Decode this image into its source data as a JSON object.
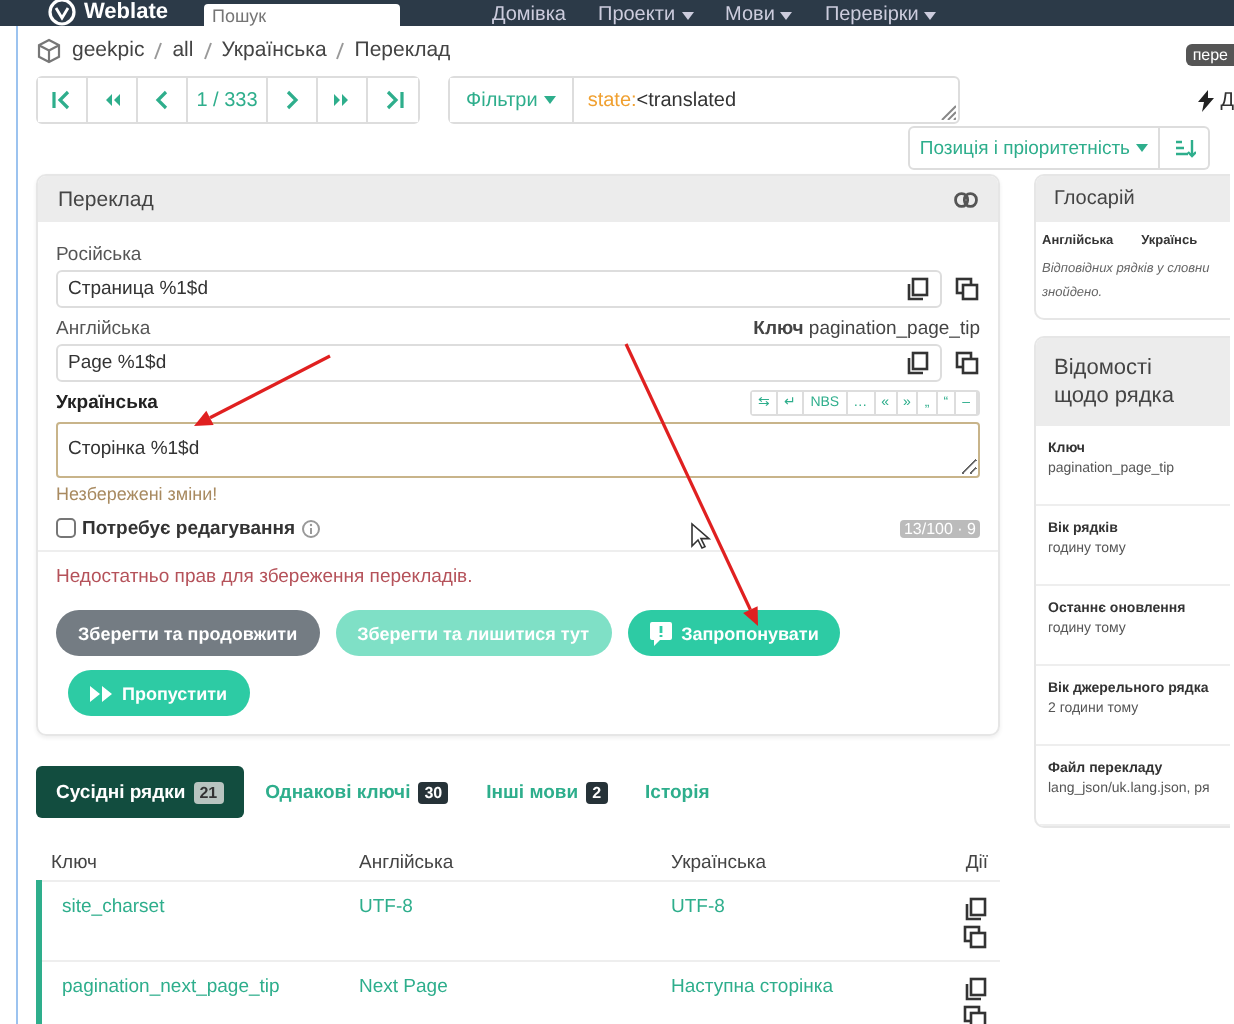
{
  "topbar": {
    "brand": "Weblate",
    "search": {
      "placeholder": "Пошук"
    },
    "menu": [
      {
        "label": "Домівка",
        "dropdown": false
      },
      {
        "label": "Проекти",
        "dropdown": true
      },
      {
        "label": "Мови",
        "dropdown": true
      },
      {
        "label": "Перевірки",
        "dropdown": true
      }
    ]
  },
  "breadcrumb": [
    "geekpic",
    "all",
    "Українська",
    "Переклад"
  ],
  "tooltip": "пере",
  "pager": {
    "position": "1 / 333"
  },
  "filter": {
    "label": "Фільтри",
    "query_key": "state:",
    "query_value": "<translated"
  },
  "zen_label": "Д",
  "sort": {
    "label": "Позиція і пріоритетність"
  },
  "translation": {
    "title": "Переклад",
    "sources": [
      {
        "language": "Російська",
        "text": "Страница %1$d"
      },
      {
        "language": "Англійська",
        "text": "Page %1$d",
        "key_label": "Ключ",
        "key": "pagination_page_tip"
      }
    ],
    "target": {
      "language": "Українська",
      "value": "Сторінка %1$d",
      "status": "Незбережені зміни!"
    },
    "special_chars": [
      "⇆",
      "↵",
      "NBS",
      "…",
      "«",
      "»",
      "„",
      "“",
      "–"
    ],
    "needs_editing": {
      "label": "Потребує редагування",
      "checked": false
    },
    "counter": "13/100 · 9",
    "message": "Недостатньо прав для збереження перекладів.",
    "buttons": [
      {
        "label": "Зберегти та продовжити",
        "kind": "secondary",
        "disabled": false
      },
      {
        "label": "Зберегти та лишитися тут",
        "kind": "primary",
        "disabled": true
      },
      {
        "label": "Запропонувати",
        "kind": "suggest",
        "disabled": false
      },
      {
        "label": "Пропустити",
        "kind": "skip",
        "disabled": false
      }
    ]
  },
  "tabs": [
    {
      "label": "Сусідні рядки",
      "count": "21",
      "selected": true
    },
    {
      "label": "Однакові ключі",
      "count": "30",
      "selected": false
    },
    {
      "label": "Інші мови",
      "count": "2",
      "selected": false
    },
    {
      "label": "Історія",
      "selected": false
    }
  ],
  "table": {
    "columns": [
      "Ключ",
      "Англійська",
      "Українська",
      "Дії"
    ],
    "rows": [
      {
        "key": "site_charset",
        "source": "UTF-8",
        "target": "UTF-8"
      },
      {
        "key": "pagination_next_page_tip",
        "source": "Next Page",
        "target": "Наступна сторінка"
      }
    ]
  },
  "glossary": {
    "title": "Глосарій",
    "columns": [
      "Англійська",
      "Українсь"
    ],
    "empty": [
      "Відповідних рядків у словни",
      "знойдено."
    ]
  },
  "info": {
    "title": "Відомості щодо рядка",
    "items": [
      {
        "label": "Ключ",
        "value": "pagination_page_tip"
      },
      {
        "label": "Вік рядків",
        "value": "годину тому"
      },
      {
        "label": "Останнє оновлення",
        "value": "годину тому"
      },
      {
        "label": "Вік джерельного рядка",
        "value": "2 години тому"
      },
      {
        "label": "Файл перекладу",
        "value": "lang_json/uk.lang.json, ря"
      }
    ]
  }
}
